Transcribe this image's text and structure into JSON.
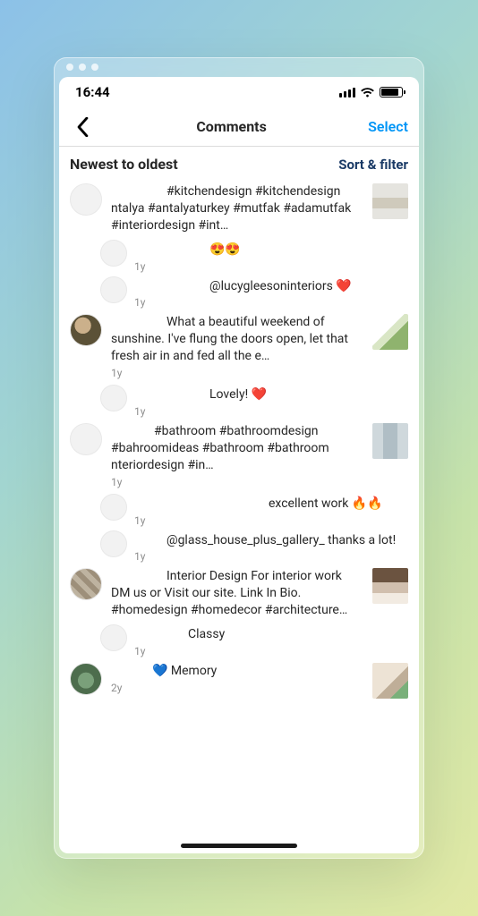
{
  "status": {
    "time": "16:44"
  },
  "nav": {
    "title": "Comments",
    "action": "Select"
  },
  "section": {
    "title": "Newest to oldest",
    "action": "Sort & filter"
  },
  "items": [
    {
      "text": "#kitchendesign #kitchendesign ntalya #antalyaturkey #mutfak #adamutfak #interiordesign #int…",
      "time": "",
      "replies": [
        {
          "text": "😍😍",
          "time": "1y"
        },
        {
          "text": "@lucygleesoninteriors ❤️",
          "time": "1y"
        }
      ]
    },
    {
      "text": "What a beautiful weekend of sunshine. I've flung the doors open, let that fresh air in and fed all the e…",
      "time": "1y",
      "replies": [
        {
          "text": "Lovely! ❤️",
          "time": "1y"
        }
      ]
    },
    {
      "text": "#bathroom #bathroomdesign #bahroomideas  #bathroom  #bathroom  nteriordesign #in…",
      "time": "1y",
      "replies": [
        {
          "text": "excellent work 🔥🔥",
          "time": "1y"
        },
        {
          "text": "@glass_house_plus_gallery_ thanks a lot!",
          "time": "1y"
        }
      ]
    },
    {
      "text": "Interior Design For interior work DM us or Visit our site. Link In Bio. #homedesign #homedecor #architecture…",
      "time": "",
      "replies": [
        {
          "text": "Classy",
          "time": "1y"
        }
      ]
    },
    {
      "text": "💙 Memory",
      "time": "2y",
      "replies": []
    }
  ]
}
